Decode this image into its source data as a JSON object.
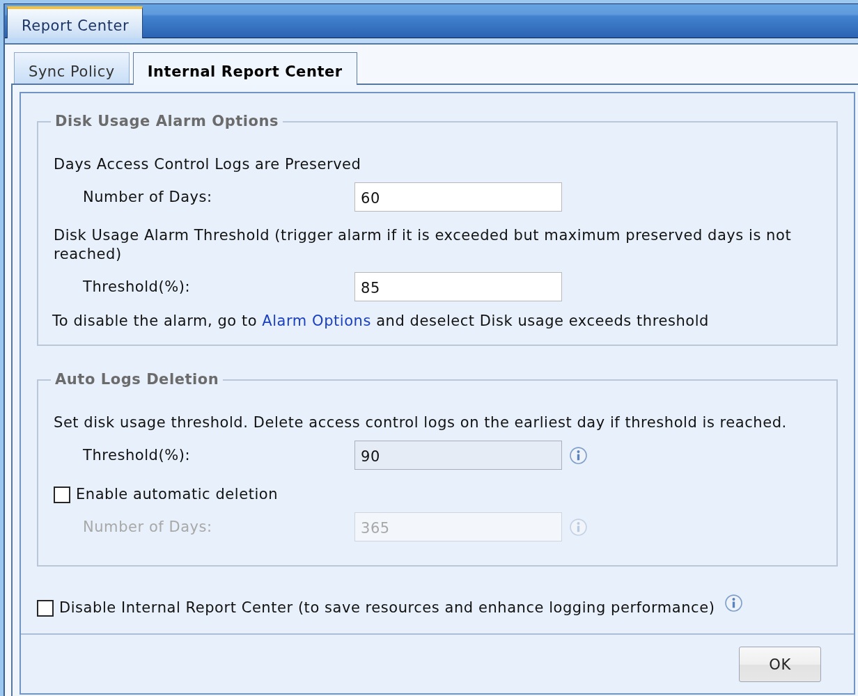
{
  "window": {
    "title": "Report Center"
  },
  "tabs": [
    {
      "label": "Sync Policy",
      "selected": false
    },
    {
      "label": "Internal Report Center",
      "selected": true
    }
  ],
  "sections": [
    {
      "title": "Disk Usage Alarm Options",
      "rows": [
        {
          "kind": "text",
          "text": "Days Access Control Logs are Preserved"
        },
        {
          "kind": "field",
          "label": "Number of Days:",
          "value": "60",
          "readonly": false,
          "disabled": false,
          "info_icon": false
        },
        {
          "kind": "text",
          "text": "Disk Usage Alarm Threshold (trigger alarm if it is exceeded but maximum preserved days is not reached)"
        },
        {
          "kind": "field",
          "label": "Threshold(%):",
          "value": "85",
          "readonly": false,
          "disabled": false,
          "info_icon": false
        },
        {
          "kind": "hint",
          "text_before": "To disable the alarm, go to ",
          "link": "Alarm Options",
          "text_after": " and deselect Disk usage exceeds threshold"
        }
      ]
    },
    {
      "title": "Auto Logs Deletion",
      "rows": [
        {
          "kind": "text",
          "text": "Set disk usage threshold. Delete access control logs on the earliest day if threshold is reached."
        },
        {
          "kind": "field",
          "label": "Threshold(%):",
          "value": "90",
          "readonly": true,
          "disabled": false,
          "info_icon": true
        },
        {
          "kind": "checkbox",
          "label": "Enable automatic deletion",
          "checked": false
        },
        {
          "kind": "field",
          "label": "Number of Days:",
          "value": "365",
          "readonly": false,
          "disabled": true,
          "info_icon": true
        }
      ]
    }
  ],
  "disable_option": {
    "label": "Disable Internal Report Center (to save resources and enhance logging performance)",
    "checked": false,
    "info_icon": true
  },
  "buttons": [
    {
      "label": "OK"
    }
  ]
}
